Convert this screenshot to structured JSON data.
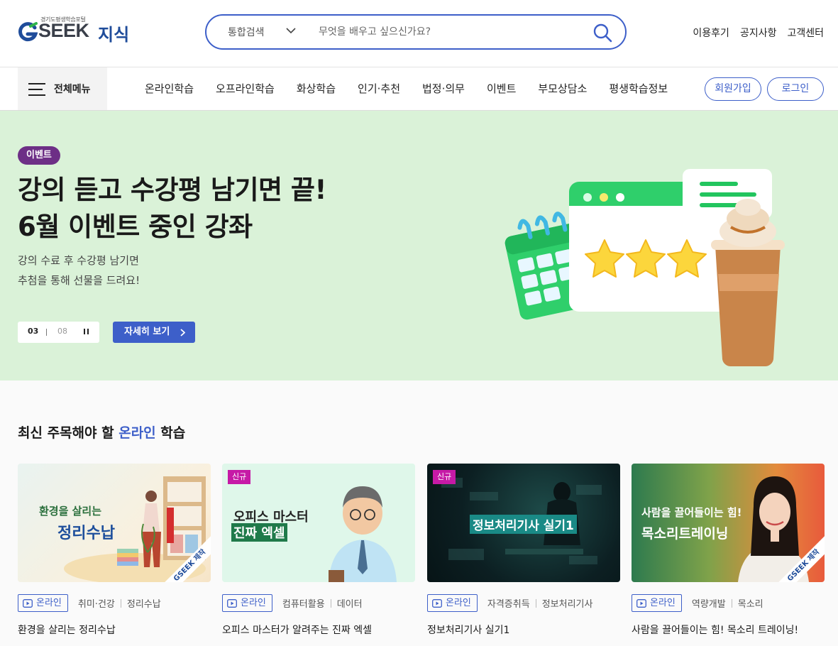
{
  "header": {
    "logo_small": "경기도평생학습포털",
    "logo_text": "SEEK",
    "logo_sub": "지식",
    "search": {
      "scope": "통합검색",
      "placeholder": "무엇을 배우고 싶으신가요?"
    },
    "util_links": [
      "이용후기",
      "공지사항",
      "고객센터"
    ]
  },
  "nav": {
    "all_menu": "전체메뉴",
    "items": [
      "온라인학습",
      "오프라인학습",
      "화상학습",
      "인기·추천",
      "법정·의무",
      "이벤트",
      "부모상담소",
      "평생학습정보"
    ],
    "signup": "회원가입",
    "login": "로그인"
  },
  "hero": {
    "badge": "이벤트",
    "title_line1": "강의 듣고 수강평 남기면 끝!",
    "title_line2": "6월 이벤트 중인 강좌",
    "desc_line1": "강의 수료 후 수강평 남기면",
    "desc_line2": "추첨을 통해 선물을 드려요!",
    "slide_current": "03",
    "slide_total": "08",
    "more_button": "자세히 보기",
    "colors": {
      "background": "#daf2d8",
      "badge": "#6d2f86",
      "button": "#3d5fc9"
    }
  },
  "courses": {
    "title_prefix": "최신 주목해야 할 ",
    "title_highlight": "온라인",
    "title_suffix": " 학습",
    "online_label": "온라인",
    "cards": [
      {
        "thumb_line1": "환경을 살리는",
        "thumb_line2": "정리수납",
        "new": "",
        "ribbon": "GSEEK 제작",
        "cat1": "취미·건강",
        "cat2": "정리수납",
        "title": "환경을 살리는 정리수납"
      },
      {
        "thumb_line1": "오피스 마스터",
        "thumb_line2": "진짜 엑셀",
        "new": "신규",
        "ribbon": "",
        "cat1": "컴퓨터활용",
        "cat2": "데이터",
        "title": "오피스 마스터가 알려주는 진짜 엑셀"
      },
      {
        "thumb_line1": "정보처리기사 실기1",
        "thumb_line2": "",
        "new": "신규",
        "ribbon": "",
        "cat1": "자격증취득",
        "cat2": "정보처리기사",
        "title": "정보처리기사 실기1"
      },
      {
        "thumb_line1": "사람을 끌어들이는 힘!",
        "thumb_line2": "목소리트레이닝",
        "new": "",
        "ribbon": "GSEEK 제작",
        "cat1": "역량개발",
        "cat2": "목소리",
        "title": "사람을 끌어들이는 힘! 목소리 트레이닝!"
      }
    ]
  },
  "icons": [
    "search-icon",
    "chevron-down-icon",
    "hamburger-icon",
    "pause-icon",
    "chevron-right-icon",
    "play-icon"
  ]
}
